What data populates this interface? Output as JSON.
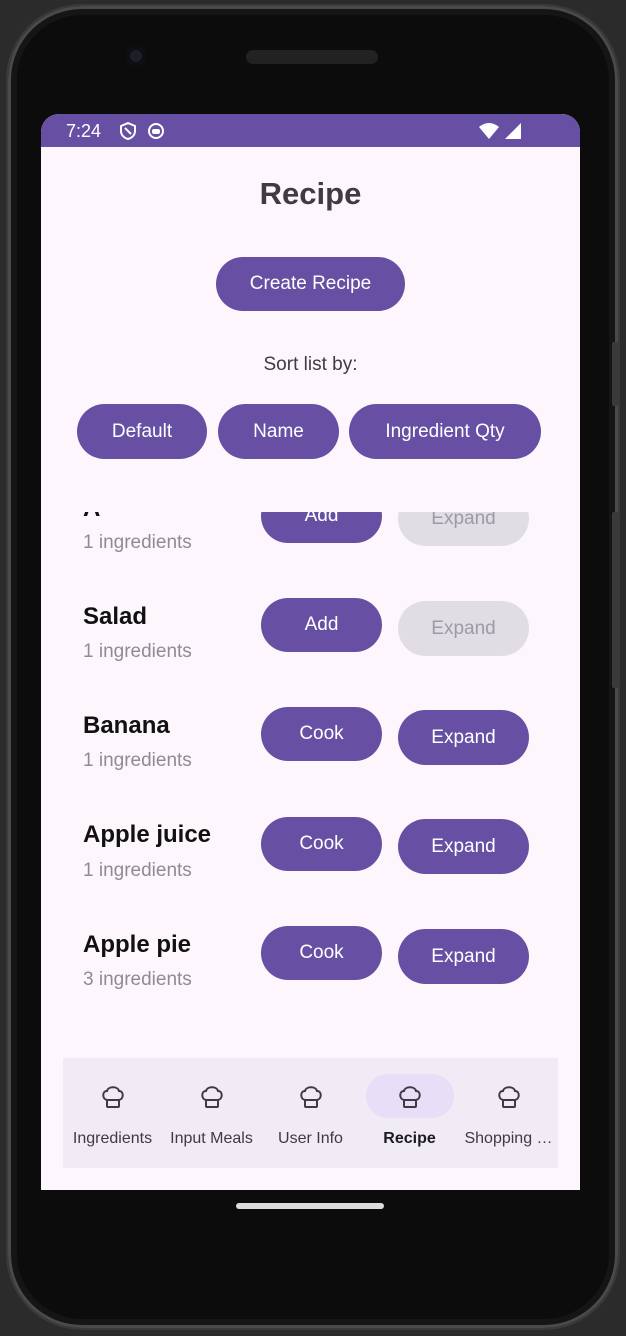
{
  "status_bar": {
    "time": "7:24",
    "color": "#6750a4"
  },
  "page": {
    "title": "Recipe",
    "create_button": "Create Recipe",
    "sort_label": "Sort list by:"
  },
  "sort_buttons": [
    "Default",
    "Name",
    "Ingredient Qty"
  ],
  "recipes": [
    {
      "name": "A",
      "count": "1 ingredients",
      "action": "Add",
      "expand": "Expand",
      "expand_enabled": false
    },
    {
      "name": "Salad",
      "count": "1 ingredients",
      "action": "Add",
      "expand": "Expand",
      "expand_enabled": false
    },
    {
      "name": "Banana",
      "count": "1 ingredients",
      "action": "Cook",
      "expand": "Expand",
      "expand_enabled": true
    },
    {
      "name": "Apple juice",
      "count": "1 ingredients",
      "action": "Cook",
      "expand": "Expand",
      "expand_enabled": true
    },
    {
      "name": "Apple pie",
      "count": "3 ingredients",
      "action": "Cook",
      "expand": "Expand",
      "expand_enabled": true
    }
  ],
  "nav": {
    "items": [
      {
        "label": "Ingredients",
        "icon": "chef-hat-icon"
      },
      {
        "label": "Input Meals",
        "icon": "chef-hat-icon"
      },
      {
        "label": "User Info",
        "icon": "chef-hat-icon"
      },
      {
        "label": "Recipe",
        "icon": "chef-hat-icon"
      },
      {
        "label": "Shopping …",
        "icon": "chef-hat-icon"
      }
    ],
    "active": "Recipe"
  },
  "colors": {
    "primary": "#6750a4",
    "background": "#fdf7fd",
    "disabled": "#e1dde5"
  }
}
